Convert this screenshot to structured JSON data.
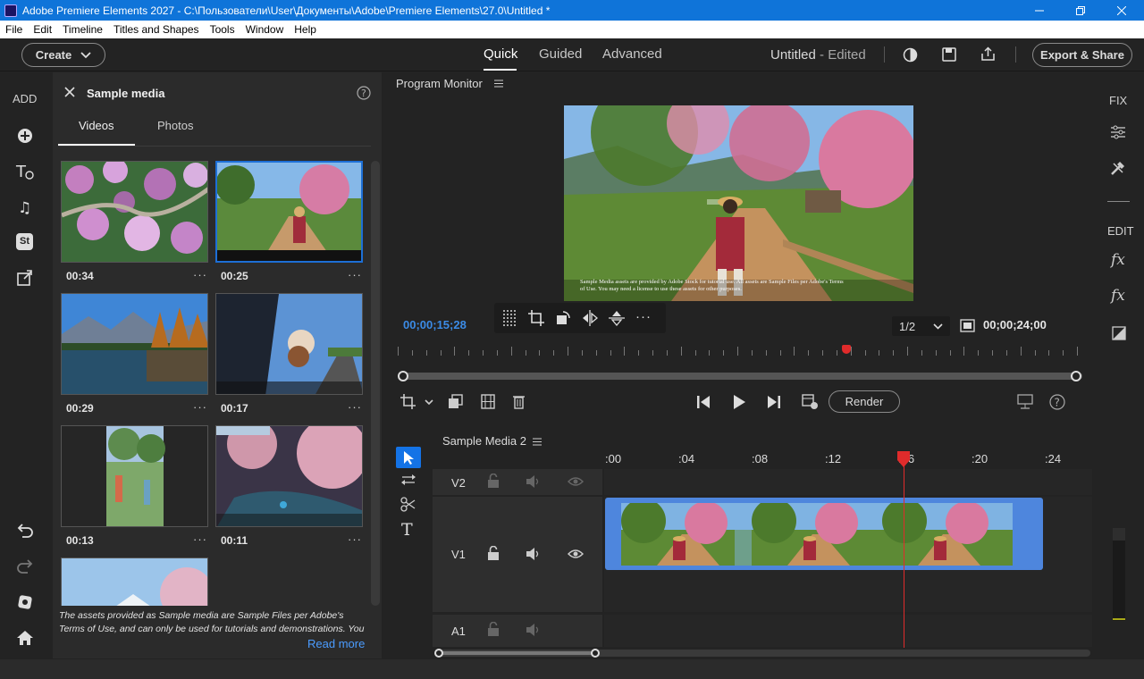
{
  "window": {
    "title": "Adobe Premiere Elements 2027 - C:\\Пользователи\\User\\Документы\\Adobe\\Premiere Elements\\27.0\\Untitled *"
  },
  "menu": [
    "File",
    "Edit",
    "Timeline",
    "Titles and Shapes",
    "Tools",
    "Window",
    "Help"
  ],
  "toolbar": {
    "create_label": "Create",
    "modes": [
      "Quick",
      "Guided",
      "Advanced"
    ],
    "project_name": "Untitled",
    "project_status": " - Edited",
    "export_label": "Export & Share"
  },
  "left_rail": {
    "add_label": "ADD"
  },
  "media_panel": {
    "title": "Sample media",
    "tabs": [
      "Videos",
      "Photos"
    ],
    "durations": [
      "00:34",
      "00:25",
      "00:29",
      "00:17",
      "00:13",
      "00:11"
    ],
    "footer_text": "The assets provided as Sample media are Sample Files per Adobe's Terms of Use, and can only be used for tutorials and demonstrations. You will need to buy a li...",
    "read_more": "Read more"
  },
  "monitor": {
    "title": "Program Monitor",
    "current_time": "00;00;15;28",
    "total_time": "00;00;24;00",
    "resolution": "1/2",
    "render_label": "Render",
    "caption": "Sample Media assets are provided by Adobe Stock for tutorial use. All assets are Sample Files per Adobe's Terms of Use. You may need a license to use these assets for other purposes.",
    "playhead_fraction": 0.66
  },
  "timeline": {
    "sequence_name": "Sample Media 2",
    "ruler_labels": [
      ":00",
      ":04",
      ":08",
      ":12",
      ":16",
      ":20",
      ":24"
    ],
    "tracks": [
      "V2",
      "V1",
      "A1"
    ]
  },
  "right_rail": {
    "fix_label": "FIX",
    "edit_label": "EDIT"
  },
  "colors": {
    "accent": "#1473e6",
    "clip": "#4e86dd",
    "playhead": "#e02b2b",
    "timecode": "#3b8be6"
  }
}
